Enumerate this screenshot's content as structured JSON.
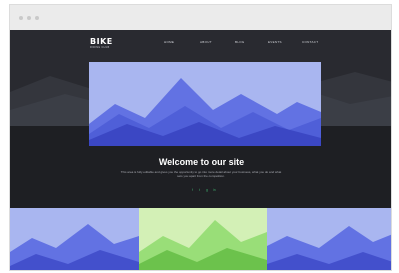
{
  "site": {
    "logo_title": "BIKE",
    "logo_subtitle": "RIDING CLUB"
  },
  "nav": {
    "items": [
      {
        "label": "HOME"
      },
      {
        "label": "ABOUT"
      },
      {
        "label": "BLOG"
      },
      {
        "label": "EVENTS"
      },
      {
        "label": "CONTACT"
      }
    ]
  },
  "hero": {
    "heading": "Welcome to our site",
    "text_line_1": "This area is fully editable and gives you the opportunity to go into more detail about your business, what you do and what",
    "text_line_2": "sets you apart from the competition."
  },
  "social": {
    "icons": [
      {
        "name": "facebook-icon",
        "glyph": "f"
      },
      {
        "name": "twitter-icon",
        "glyph": "t"
      },
      {
        "name": "google-plus-icon",
        "glyph": "g"
      },
      {
        "name": "linkedin-icon",
        "glyph": "in"
      }
    ]
  },
  "colors": {
    "background_dark": "#1e1f23",
    "sky_blue": "#a9b6f0",
    "mountain_blue": "#5262dd",
    "mountain_dark_blue": "#3b47c4",
    "sky_green": "#d3f0b6",
    "mountain_green": "#7cd15e",
    "accent_green": "#3ea76a"
  }
}
